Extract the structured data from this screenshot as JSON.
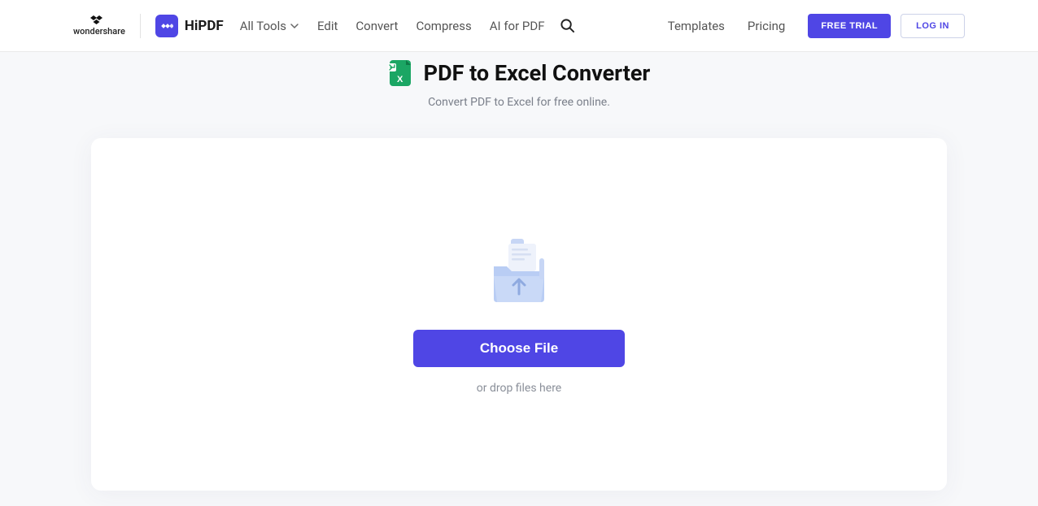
{
  "header": {
    "brand_primary": "wondershare",
    "brand_secondary": "HiPDF",
    "nav": {
      "all_tools": "All Tools",
      "edit": "Edit",
      "convert": "Convert",
      "compress": "Compress",
      "ai_for_pdf": "AI for PDF"
    },
    "right": {
      "templates": "Templates",
      "pricing": "Pricing",
      "free_trial": "FREE TRIAL",
      "login": "LOG IN"
    }
  },
  "main": {
    "title": "PDF to Excel Converter",
    "subtitle": "Convert PDF to Excel for free online.",
    "choose_file": "Choose File",
    "drop_hint": "or drop files here"
  },
  "colors": {
    "accent": "#4f46e5",
    "excel_green": "#1ba664"
  }
}
